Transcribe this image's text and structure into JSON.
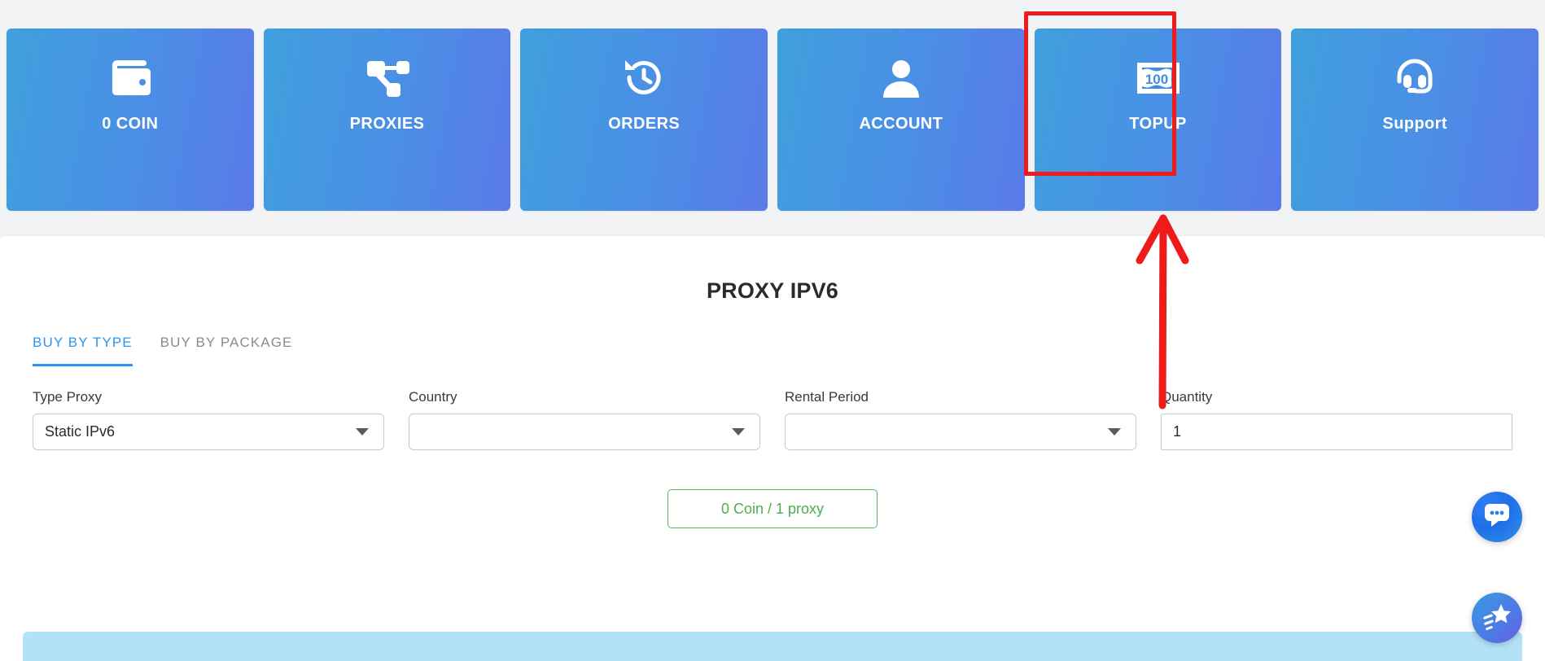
{
  "nav": {
    "cards": [
      {
        "label": "0 COIN",
        "icon": "wallet-icon"
      },
      {
        "label": "PROXIES",
        "icon": "network-nodes-icon"
      },
      {
        "label": "ORDERS",
        "icon": "history-clock-icon"
      },
      {
        "label": "ACCOUNT",
        "icon": "person-icon"
      },
      {
        "label": "TOPUP",
        "icon": "banknote-100-icon"
      },
      {
        "label": "Support",
        "icon": "headset-icon"
      }
    ]
  },
  "annotation": {
    "highlight_target": "TOPUP",
    "color": "#ee1b1b"
  },
  "panel": {
    "title": "PROXY IPV6",
    "tabs": [
      {
        "label": "BUY BY TYPE",
        "active": true
      },
      {
        "label": "BUY BY PACKAGE",
        "active": false
      }
    ],
    "fields": [
      {
        "label": "Type Proxy",
        "value": "Static IPv6",
        "placeholder": "",
        "kind": "select"
      },
      {
        "label": "Country",
        "value": "",
        "placeholder": "",
        "kind": "select"
      },
      {
        "label": "Rental Period",
        "value": "",
        "placeholder": "",
        "kind": "select"
      },
      {
        "label": "Quantity",
        "value": "1",
        "placeholder": "",
        "kind": "number"
      }
    ],
    "price_button": "0 Coin / 1 proxy"
  },
  "fabs": [
    {
      "name": "chat-bubble-icon",
      "title": "Chat"
    },
    {
      "name": "shooting-star-icon",
      "title": "Rate"
    }
  ],
  "colors": {
    "accent_blue": "#2d95ef",
    "card_gradient_start": "#3fa0dd",
    "card_gradient_end": "#5a7ae8",
    "price_green": "#4caf50",
    "annotation_red": "#ee1b1b",
    "banner_blue": "#b3e2f8"
  }
}
